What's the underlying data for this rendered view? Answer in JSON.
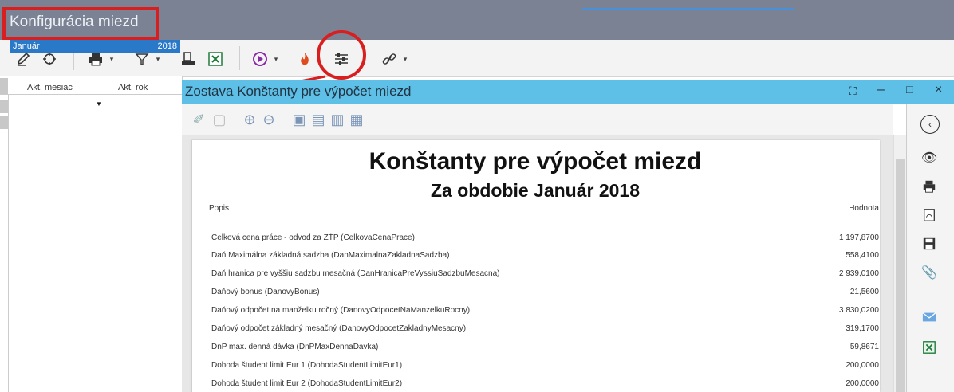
{
  "app": {
    "title": "Konfigurácia miezd"
  },
  "colors": {
    "title_bar": "#7a8293",
    "report_header": "#5ec0e6",
    "selected_row": "#2a78c8",
    "annotation": "#d81e1e"
  },
  "toolbar": {
    "items": [
      "pencil-icon",
      "refresh-icon",
      "printer-icon",
      "filter-icon",
      "print-preview-icon",
      "excel-icon",
      "play-icon",
      "fire-icon",
      "settings-sliders-icon",
      "link-icon"
    ]
  },
  "left_panel": {
    "headers": [
      "Akt. mesiac",
      "Akt. rok"
    ],
    "rows": [
      {
        "month": "Január",
        "year": "2018"
      }
    ]
  },
  "report_window": {
    "title": "Zostava Konštanty pre výpočet miezd",
    "toolbar_icons": [
      "eraser-icon",
      "copy-icon",
      "zoom-in-icon",
      "zoom-out-icon",
      "page-layout-1-icon",
      "page-layout-2-icon",
      "page-layout-3-icon",
      "page-layout-4-icon"
    ],
    "side_icons": [
      "back-icon",
      "eye-icon",
      "printer-icon",
      "pdf-icon",
      "save-icon",
      "attach-icon",
      "email-icon",
      "excel-icon"
    ]
  },
  "document": {
    "title": "Konštanty pre výpočet miezd",
    "subtitle": "Za obdobie Január 2018",
    "col_popis": "Popis",
    "col_hodnota": "Hodnota",
    "rows": [
      {
        "label": "Celková cena práce - odvod za ZŤP (CelkovaCenaPrace)",
        "value": "1 197,8700"
      },
      {
        "label": "Daň Maximálna základná sadzba (DanMaximalnaZakladnaSadzba)",
        "value": "558,4100"
      },
      {
        "label": "Daň hranica pre vyššiu sadzbu mesačná (DanHranicaPreVyssiuSadzbuMesacna)",
        "value": "2 939,0100"
      },
      {
        "label": "Daňový bonus (DanovyBonus)",
        "value": "21,5600"
      },
      {
        "label": "Daňový odpočet na manželku ročný (DanovyOdpocetNaManzelkuRocny)",
        "value": "3 830,0200"
      },
      {
        "label": "Daňový odpočet základný mesačný (DanovyOdpocetZakladnyMesacny)",
        "value": "319,1700"
      },
      {
        "label": "DnP max. denná dávka (DnPMaxDennaDavka)",
        "value": "59,8671"
      },
      {
        "label": "Dohoda študent limit Eur 1 (DohodaStudentLimitEur1)",
        "value": "200,0000"
      },
      {
        "label": "Dohoda študent limit Eur 2 (DohodaStudentLimitEur2)",
        "value": "200,0000"
      }
    ]
  }
}
